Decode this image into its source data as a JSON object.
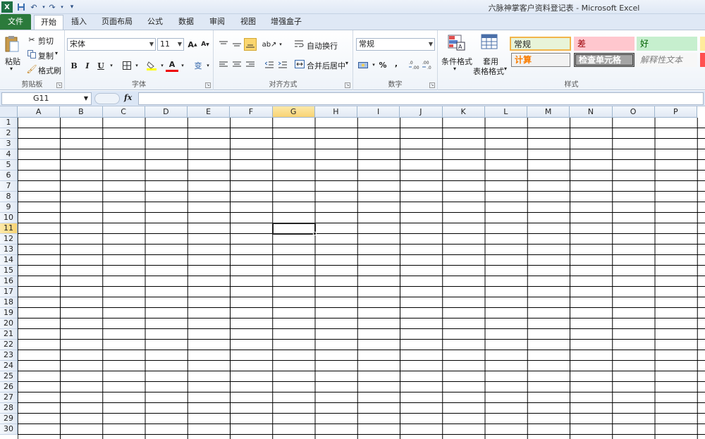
{
  "window": {
    "title": "六脉神掌客户资料登记表 - Microsoft Excel"
  },
  "tabs": {
    "file": "文件",
    "items": [
      "开始",
      "插入",
      "页面布局",
      "公式",
      "数据",
      "审阅",
      "视图",
      "增强盒子"
    ],
    "active_index": 0
  },
  "ribbon": {
    "clipboard": {
      "paste": "粘贴",
      "cut": "剪切",
      "copy": "复制",
      "format_painter": "格式刷",
      "label": "剪贴板"
    },
    "font": {
      "name": "宋体",
      "size": "11",
      "bold": "B",
      "italic": "I",
      "underline": "U",
      "label": "字体"
    },
    "alignment": {
      "wrap_text": "自动换行",
      "merge_center": "合并后居中",
      "label": "对齐方式"
    },
    "number": {
      "format": "常规",
      "percent": "%",
      "comma": ",",
      "inc_decimal": ".0→.00",
      "dec_decimal": ".00→.0",
      "label": "数字"
    },
    "styles": {
      "conditional_format": "条件格式",
      "table_format_line1": "套用",
      "table_format_line2": "表格格式",
      "cells": [
        {
          "text": "常规",
          "bg": "#e8f4d9",
          "color": "#000000",
          "border": "#f2b54a"
        },
        {
          "text": "差",
          "bg": "#ffc7ce",
          "color": "#9c0006",
          "border": "#ffc7ce"
        },
        {
          "text": "好",
          "bg": "#c6efce",
          "color": "#006100",
          "border": "#c6efce"
        },
        {
          "text": "计算",
          "bg": "#f2f2f2",
          "color": "#fa7d00",
          "border": "#7f7f7f"
        },
        {
          "text": "检查单元格",
          "bg": "#a5a5a5",
          "color": "#ffffff",
          "border": "#3f3f3f"
        },
        {
          "text": "解释性文本",
          "bg": "#ffffff",
          "color": "#7f7f7f",
          "border": "#ffffff"
        }
      ],
      "label": "样式"
    }
  },
  "formula_bar": {
    "name_box": "G11",
    "fx": "fx",
    "value": ""
  },
  "sheet": {
    "columns": [
      "A",
      "B",
      "C",
      "D",
      "E",
      "F",
      "G",
      "H",
      "I",
      "J",
      "K",
      "L",
      "M",
      "N",
      "O",
      "P"
    ],
    "rows": [
      "1",
      "2",
      "3",
      "4",
      "5",
      "6",
      "7",
      "8",
      "9",
      "10",
      "11",
      "12",
      "13",
      "14",
      "15",
      "16",
      "17",
      "18",
      "19",
      "20",
      "21",
      "22",
      "23",
      "24",
      "25",
      "26",
      "27",
      "28",
      "29",
      "30"
    ],
    "active_column": "G",
    "active_row": "11"
  }
}
